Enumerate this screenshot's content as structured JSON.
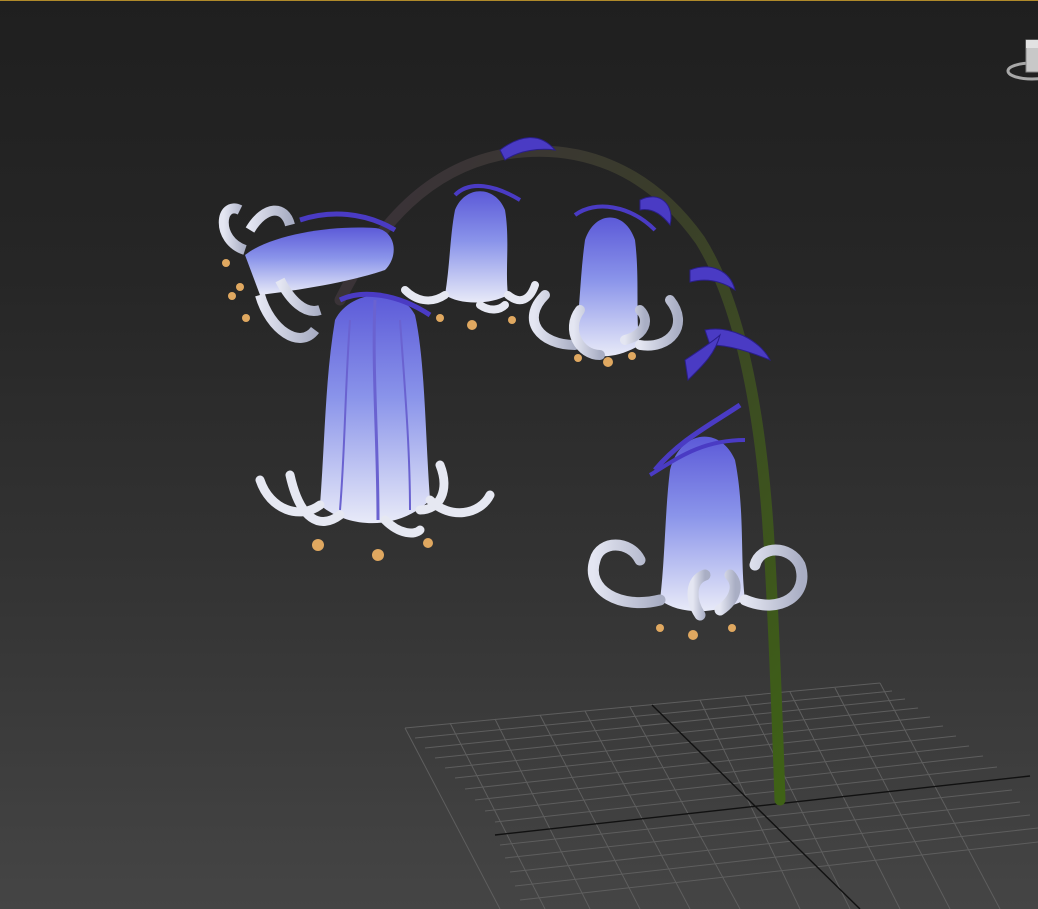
{
  "viewport": {
    "label": "",
    "background_top": "#1f1f1f",
    "background_bottom": "#454545",
    "active_border_color": "#b08a2a"
  },
  "scene": {
    "object": "bluebell-flower-model",
    "stem_color": "#3d5a14",
    "petal_color": "#8a94ea",
    "petal_dark": "#4a3bc4",
    "anther_color": "#e0a860",
    "grid_color": "#6a6a6a"
  },
  "icons": {
    "viewcube": "viewcube-icon"
  }
}
